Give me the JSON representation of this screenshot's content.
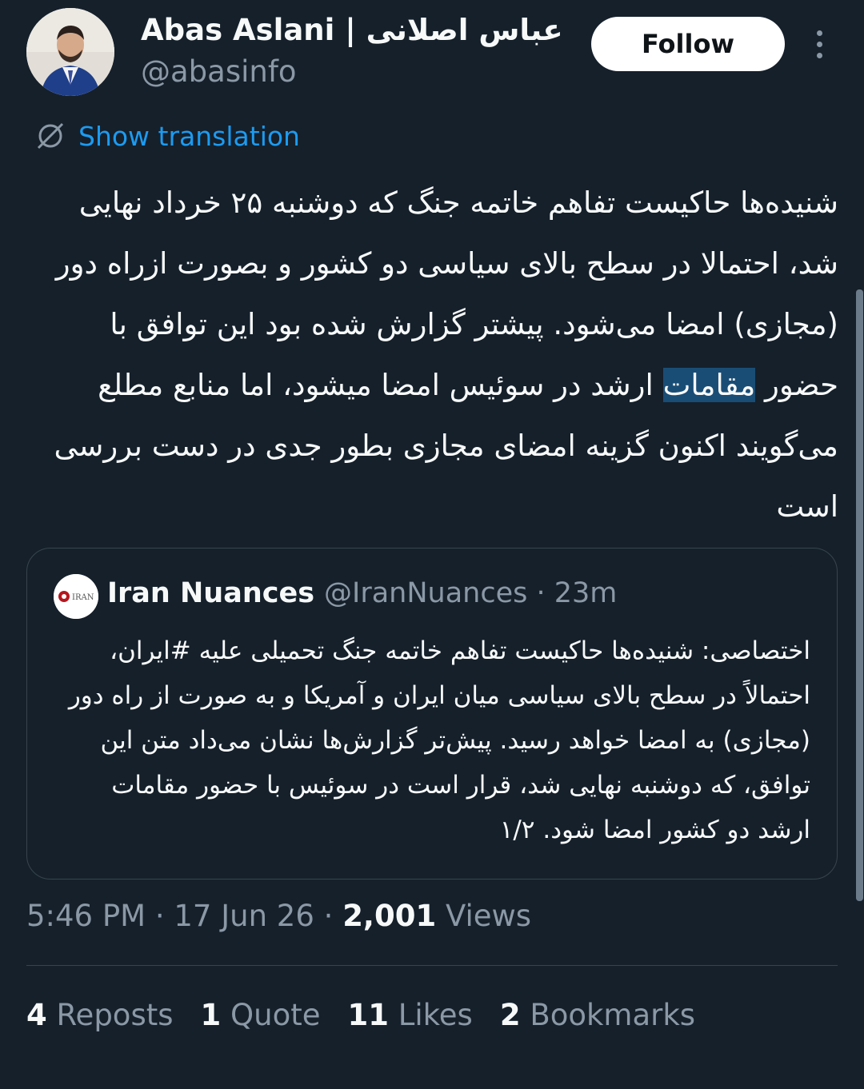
{
  "author": {
    "name": "Abas Aslani | عباس اصلانی",
    "handle": "@abasinfo"
  },
  "follow_label": "Follow",
  "translate_label": "Show translation",
  "tweet": {
    "before_highlight": "شنیده‌ها حاکیست تفاهم خاتمه جنگ که دوشنبه ۲۵ خرداد نهایی شد، احتمالا در سطح بالای سیاسی دو کشور و بصورت ازراه دور (مجازی) امضا می‌شود. پیشتر گزارش شده بود این توافق با حضور ",
    "highlight": "مقامات",
    "after_highlight": " ارشد در سوئیس امضا میشود، اما منابع مطلع می‌گویند اکنون گزینه امضای مجازی بطور جدی در دست بررسی است"
  },
  "quote": {
    "name": "Iran Nuances",
    "handle_time": "@IranNuances · 23m",
    "avatar_text": "IRAN",
    "text": "اختصاصی: شنیده‌ها حاکیست تفاهم خاتمه جنگ تحمیلی علیه #ایران، احتمالاً در سطح بالای سیاسی میان ایران و آمریکا و به صورت از راه دور (مجازی) به امضا خواهد رسید. پیش‌تر گزارش‌ها نشان می‌داد متن این توافق، که دوشنبه نهایی شد، قرار است در سوئیس با حضور مقامات ارشد دو کشور امضا شود. ۱/۲"
  },
  "meta": {
    "time": "5:46 PM",
    "date": "17 Jun 26",
    "views_count": "2,001",
    "views_label": "Views"
  },
  "stats": [
    {
      "count": "4",
      "label": "Reposts"
    },
    {
      "count": "1",
      "label": "Quote"
    },
    {
      "count": "11",
      "label": "Likes"
    },
    {
      "count": "2",
      "label": "Bookmarks"
    }
  ],
  "icons": {
    "avatar": "user-photo",
    "more": "more-vertical-icon",
    "translate": "translate-off-icon"
  }
}
